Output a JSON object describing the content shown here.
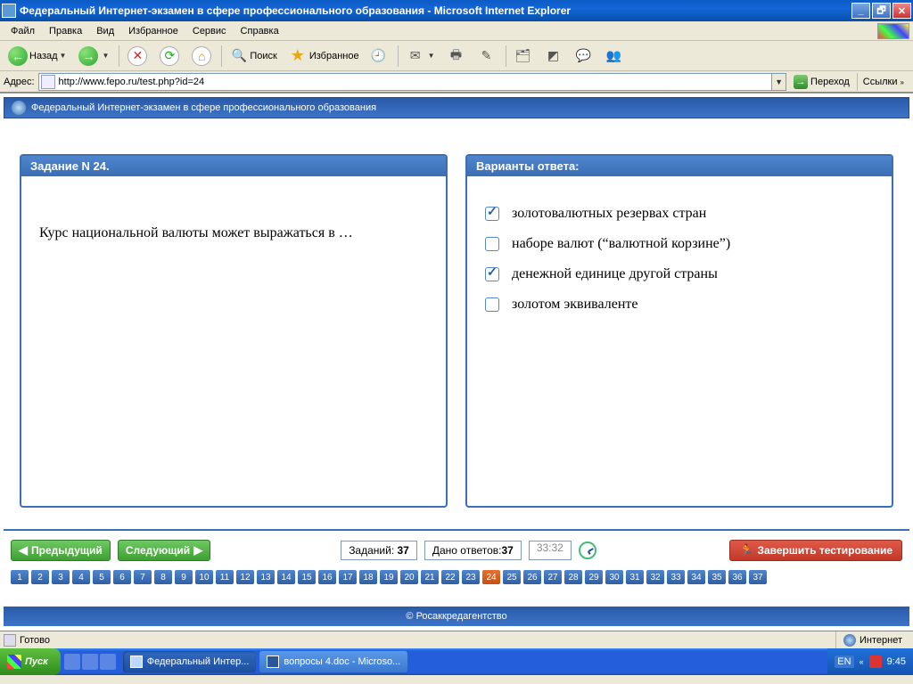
{
  "window": {
    "title": "Федеральный Интернет-экзамен в сфере профессионального образования - Microsoft Internet Explorer"
  },
  "menu": {
    "items": [
      "Файл",
      "Правка",
      "Вид",
      "Избранное",
      "Сервис",
      "Справка"
    ]
  },
  "toolbar": {
    "back": "Назад",
    "search": "Поиск",
    "favorites": "Избранное"
  },
  "address": {
    "label": "Адрес:",
    "url": "http://www.fepo.ru/test.php?id=24",
    "go": "Переход",
    "links": "Ссылки"
  },
  "page": {
    "header": "Федеральный Интернет-экзамен в сфере профессионального образования",
    "task_panel_title": "Задание N 24.",
    "task_text": "Курс национальной валюты может выражаться в …",
    "answers_panel_title": "Варианты ответа:",
    "answers": [
      {
        "text": "золотовалютных резервах стран",
        "checked": true
      },
      {
        "text": "наборе валют (“валютной корзине”)",
        "checked": false
      },
      {
        "text": "денежной единице другой страны",
        "checked": true
      },
      {
        "text": "золотом эквиваленте",
        "checked": false
      }
    ],
    "prev": "Предыдущий",
    "next": "Следующий",
    "tasks_label": "Заданий:",
    "tasks_count": "37",
    "answered_label": "Дано ответов:",
    "answered_count": "37",
    "timer": "33:32",
    "finish": "Завершить тестирование",
    "total_questions": 37,
    "current_question": 24,
    "footer": "© Росаккредагентство"
  },
  "statusbar": {
    "status": "Готово",
    "zone": "Интернет"
  },
  "taskbar": {
    "start": "Пуск",
    "items": [
      {
        "label": "Федеральный Интер...",
        "type": "ie",
        "active": true
      },
      {
        "label": "вопросы 4.doc - Microso...",
        "type": "word",
        "active": false
      }
    ],
    "lang": "EN",
    "time": "9:45"
  }
}
